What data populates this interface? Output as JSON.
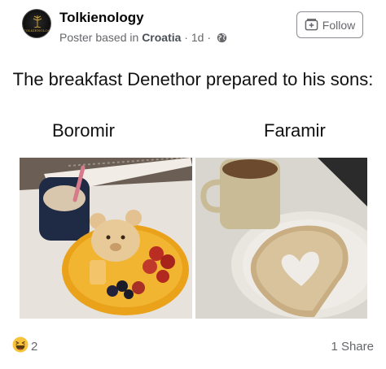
{
  "post": {
    "page_name": "Tolkienology",
    "poster_prefix": "Poster based in",
    "poster_location": "Croatia",
    "sep1": " · ",
    "time": "1d",
    "sep2": " · ",
    "follow_label": "Follow",
    "avatar_text": "TOLKIENOLOGY"
  },
  "meme": {
    "caption": "The breakfast Denethor prepared to his sons:",
    "left_label": "Boromir",
    "right_label": "Faramir"
  },
  "footer": {
    "reaction_count": "2",
    "share_count": "1 Share"
  },
  "icons": {
    "avatar": "tree-logo",
    "follow": "add-page-icon",
    "privacy": "globe-icon",
    "reaction": "haha-emoji-icon"
  }
}
